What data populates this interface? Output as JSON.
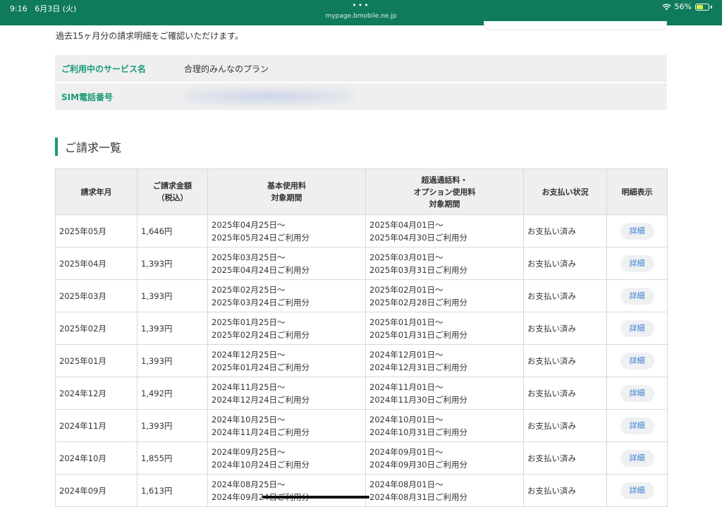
{
  "statusbar": {
    "time": "9:16",
    "date": "6月3日 (火)",
    "dots": "•••",
    "url": "mypage.bmobile.ne.jp",
    "battery_percent": "56%",
    "battery_level": 0.56,
    "wifi_icon": "wifi-icon",
    "bg_color": "#0f7a5c"
  },
  "intro": "過去15ヶ月分の請求明細をご確認いただけます。",
  "service": {
    "plan_label": "ご利用中のサービス名",
    "plan_value": "合理的みんなのプラン",
    "sim_label": "SIM電話番号",
    "sim_value": ""
  },
  "section_title": "ご請求一覧",
  "accent_color": "#1a9a78",
  "table": {
    "headers": {
      "month": "請求年月",
      "amount_1": "ご請求金額",
      "amount_2": "（税込）",
      "basic_1": "基本使用料",
      "basic_2": "対象期間",
      "over_1": "超過通話料・",
      "over_2": "オプション使用料",
      "over_3": "対象期間",
      "status": "お支払い状況",
      "detail": "明細表示"
    },
    "rows": [
      {
        "month": "2025年05月",
        "amount": "1,646円",
        "basic_from": "2025年04月25日〜",
        "basic_to": "2025年05月24日ご利用分",
        "over_from": "2025年04月01日〜",
        "over_to": "2025年04月30日ご利用分",
        "status": "お支払い済み",
        "detail": "詳細"
      },
      {
        "month": "2025年04月",
        "amount": "1,393円",
        "basic_from": "2025年03月25日〜",
        "basic_to": "2025年04月24日ご利用分",
        "over_from": "2025年03月01日〜",
        "over_to": "2025年03月31日ご利用分",
        "status": "お支払い済み",
        "detail": "詳細"
      },
      {
        "month": "2025年03月",
        "amount": "1,393円",
        "basic_from": "2025年02月25日〜",
        "basic_to": "2025年03月24日ご利用分",
        "over_from": "2025年02月01日〜",
        "over_to": "2025年02月28日ご利用分",
        "status": "お支払い済み",
        "detail": "詳細"
      },
      {
        "month": "2025年02月",
        "amount": "1,393円",
        "basic_from": "2025年01月25日〜",
        "basic_to": "2025年02月24日ご利用分",
        "over_from": "2025年01月01日〜",
        "over_to": "2025年01月31日ご利用分",
        "status": "お支払い済み",
        "detail": "詳細"
      },
      {
        "month": "2025年01月",
        "amount": "1,393円",
        "basic_from": "2024年12月25日〜",
        "basic_to": "2025年01月24日ご利用分",
        "over_from": "2024年12月01日〜",
        "over_to": "2024年12月31日ご利用分",
        "status": "お支払い済み",
        "detail": "詳細"
      },
      {
        "month": "2024年12月",
        "amount": "1,492円",
        "basic_from": "2024年11月25日〜",
        "basic_to": "2024年12月24日ご利用分",
        "over_from": "2024年11月01日〜",
        "over_to": "2024年11月30日ご利用分",
        "status": "お支払い済み",
        "detail": "詳細"
      },
      {
        "month": "2024年11月",
        "amount": "1,393円",
        "basic_from": "2024年10月25日〜",
        "basic_to": "2024年11月24日ご利用分",
        "over_from": "2024年10月01日〜",
        "over_to": "2024年10月31日ご利用分",
        "status": "お支払い済み",
        "detail": "詳細"
      },
      {
        "month": "2024年10月",
        "amount": "1,855円",
        "basic_from": "2024年09月25日〜",
        "basic_to": "2024年10月24日ご利用分",
        "over_from": "2024年09月01日〜",
        "over_to": "2024年09月30日ご利用分",
        "status": "お支払い済み",
        "detail": "詳細"
      },
      {
        "month": "2024年09月",
        "amount": "1,613円",
        "basic_from": "2024年08月25日〜",
        "basic_to": "2024年09月24日ご利用分",
        "over_from": "2024年08月01日〜",
        "over_to": "2024年08月31日ご利用分",
        "status": "お支払い済み",
        "detail": "詳細"
      }
    ]
  }
}
